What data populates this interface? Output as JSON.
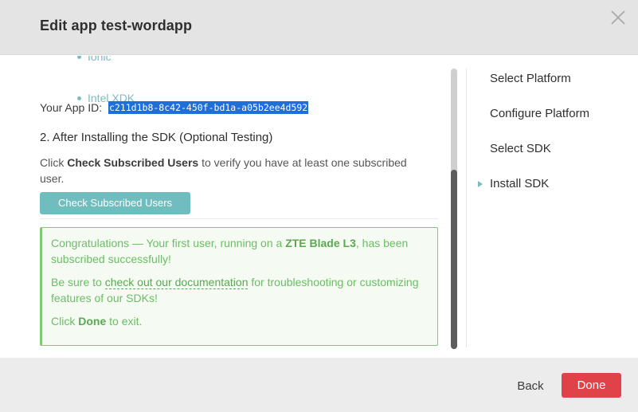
{
  "dialog": {
    "title": "Edit app test-wordapp",
    "close_icon": "close-icon"
  },
  "content": {
    "platform_list": [
      {
        "label": "Ionic"
      },
      {
        "label": "Intel XDK"
      }
    ],
    "app_id_label": "Your App ID:",
    "app_id_value": "c211d1b8-8c42-450f-bd1a-a05b2ee4d592",
    "step_heading": "2. After Installing the SDK (Optional Testing)",
    "desc_prefix": "Click ",
    "desc_bold": "Check Subscribed Users",
    "desc_suffix": " to verify you have at least one subscribed user.",
    "check_button_label": "Check Subscribed Users",
    "success": {
      "line1_prefix": "Congratulations — Your first user, running on a ",
      "line1_device": "ZTE Blade L3",
      "line1_suffix": ", has been subscribed successfully!",
      "line2_prefix": "Be sure to ",
      "line2_link": "check out our documentation",
      "line2_suffix": " for troubleshooting or customizing features of our SDKs!",
      "line3_prefix": "Click ",
      "line3_bold": "Done",
      "line3_suffix": " to exit."
    }
  },
  "steps": {
    "items": [
      {
        "label": "Select Platform"
      },
      {
        "label": "Configure Platform"
      },
      {
        "label": "Select SDK"
      },
      {
        "label": "Install SDK"
      }
    ],
    "active_index": 3,
    "arrow_icon": "triangle-right-icon"
  },
  "footer": {
    "back_label": "Back",
    "done_label": "Done"
  },
  "colors": {
    "accent_teal": "#6fbdbf",
    "success_green": "#6bbd65",
    "done_red": "#e0424a",
    "selection_blue": "#1e6fd9"
  }
}
